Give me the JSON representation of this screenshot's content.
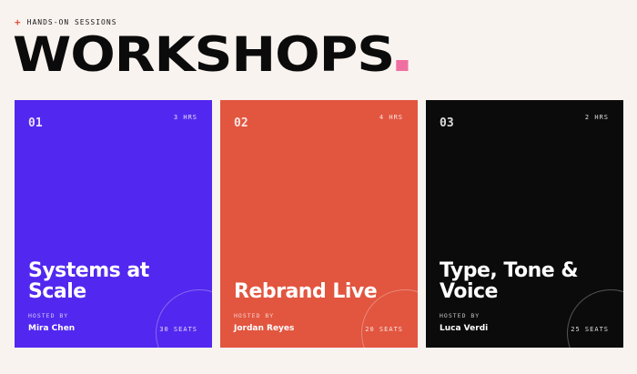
{
  "header": {
    "eyebrow_icon": "sparkle-icon",
    "eyebrow": "HANDS-ON SESSIONS",
    "title": "WORKSHOPS",
    "accent_color": "#ef6fa1"
  },
  "workshops": [
    {
      "number": "01",
      "duration": "3 HRS",
      "title": "Systems at Scale",
      "hosted_label": "HOSTED BY",
      "host": "Mira Chen",
      "seats": "30 SEATS",
      "color": "#5227ef"
    },
    {
      "number": "02",
      "duration": "4 HRS",
      "title": "Rebrand Live",
      "hosted_label": "HOSTED BY",
      "host": "Jordan Reyes",
      "seats": "20 SEATS",
      "color": "#e2553f"
    },
    {
      "number": "03",
      "duration": "2 HRS",
      "title": "Type, Tone & Voice",
      "hosted_label": "HOSTED BY",
      "host": "Luca Verdi",
      "seats": "25 SEATS",
      "color": "#0c0b0b"
    }
  ]
}
